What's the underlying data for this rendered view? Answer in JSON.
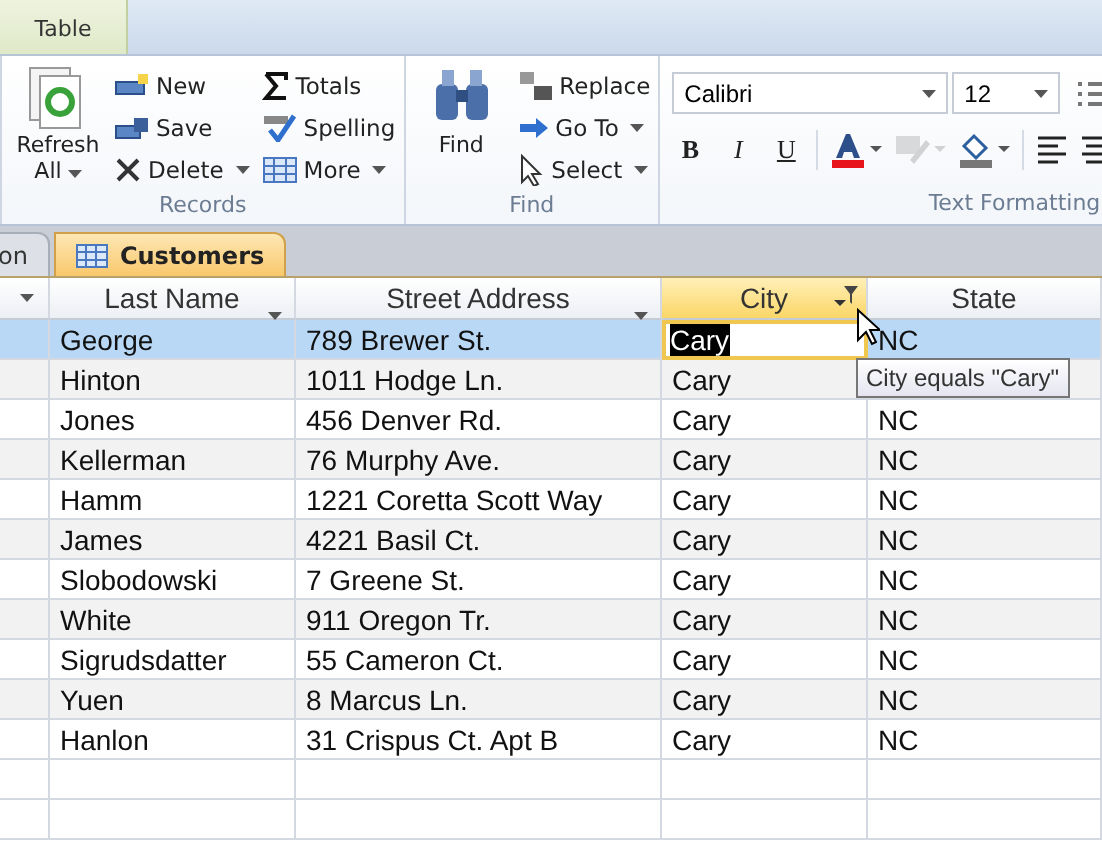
{
  "ribbon": {
    "context_tab": "Table",
    "records": {
      "title": "Records",
      "refresh": "Refresh All",
      "buttons": [
        {
          "label": "New",
          "kind": "new",
          "dropdown": false
        },
        {
          "label": "Save",
          "kind": "save",
          "dropdown": false
        },
        {
          "label": "Delete",
          "kind": "delete",
          "dropdown": true
        },
        {
          "label": "Totals",
          "kind": "totals",
          "dropdown": false
        },
        {
          "label": "Spelling",
          "kind": "spelling",
          "dropdown": false
        },
        {
          "label": "More",
          "kind": "more",
          "dropdown": true
        }
      ]
    },
    "find": {
      "title": "Find",
      "find": "Find",
      "buttons": [
        {
          "label": "Replace",
          "kind": "replace",
          "dropdown": false
        },
        {
          "label": "Go To",
          "kind": "goto",
          "dropdown": true
        },
        {
          "label": "Select",
          "kind": "select",
          "dropdown": true
        }
      ]
    },
    "text_formatting": {
      "title": "Text Formatting",
      "font": "Calibri",
      "size": "12",
      "styles": [
        "B",
        "I",
        "U"
      ],
      "disabled_highlight": true
    }
  },
  "doc_tabs": [
    {
      "label": "on",
      "selected": false
    },
    {
      "label": "Customers",
      "selected": true
    }
  ],
  "table": {
    "columns": [
      {
        "label": "Last Name",
        "filtered": false
      },
      {
        "label": "Street Address",
        "filtered": false
      },
      {
        "label": "City",
        "filtered": true
      },
      {
        "label": "State",
        "filtered": false
      }
    ],
    "rows": [
      {
        "cells": [
          "George",
          "789 Brewer St.",
          "Cary",
          "NC"
        ],
        "selected": true
      },
      {
        "cells": [
          "Hinton",
          "1011 Hodge Ln.",
          "Cary"
        ],
        "selected": false
      },
      {
        "cells": [
          "Jones",
          "456 Denver Rd.",
          "Cary",
          "NC"
        ],
        "selected": false
      },
      {
        "cells": [
          "Kellerman",
          "76 Murphy Ave.",
          "Cary",
          "NC"
        ],
        "selected": false
      },
      {
        "cells": [
          "Hamm",
          "1221 Coretta Scott Way",
          "Cary",
          "NC"
        ],
        "selected": false
      },
      {
        "cells": [
          "James",
          "4221 Basil Ct.",
          "Cary",
          "NC"
        ],
        "selected": false
      },
      {
        "cells": [
          "Slobodowski",
          "7 Greene St.",
          "Cary",
          "NC"
        ],
        "selected": false
      },
      {
        "cells": [
          "White",
          "911 Oregon Tr.",
          "Cary",
          "NC"
        ],
        "selected": false
      },
      {
        "cells": [
          "Sigrudsdatter",
          "55 Cameron Ct.",
          "Cary",
          "NC"
        ],
        "selected": false
      },
      {
        "cells": [
          "Yuen",
          "8 Marcus Ln.",
          "Cary",
          "NC"
        ],
        "selected": false
      },
      {
        "cells": [
          "Hanlon",
          "31 Crispus Ct. Apt B",
          "Cary",
          "NC"
        ],
        "selected": false
      }
    ]
  },
  "tooltip": "City equals \"Cary\""
}
